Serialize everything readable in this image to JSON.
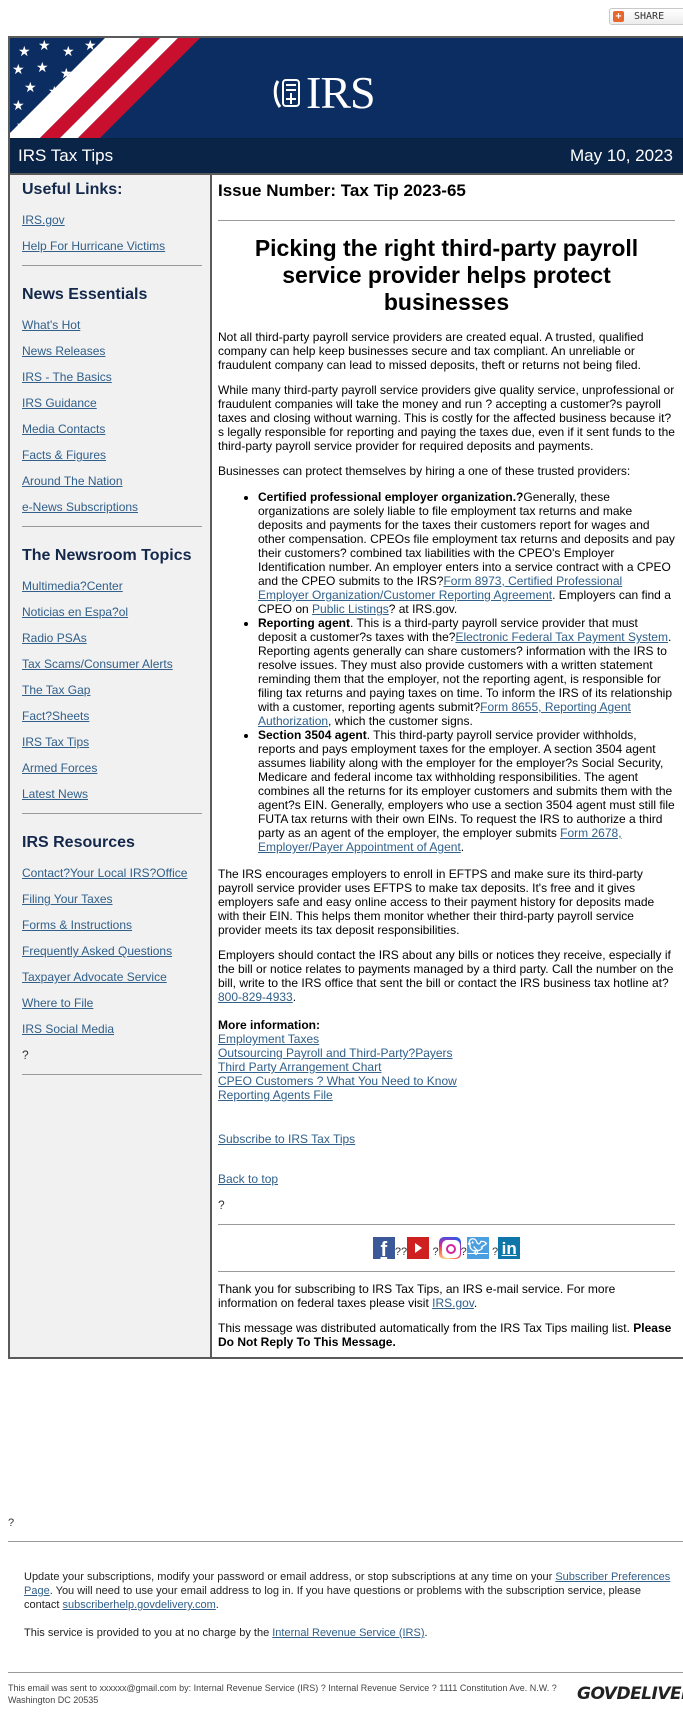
{
  "share": {
    "label": "SHARE",
    "icon": "plus-square-icon"
  },
  "banner": {
    "logo_text": "IRS",
    "logo_icon": "irs-eagle-seal-icon"
  },
  "titlebar": {
    "title": "IRS Tax Tips",
    "date": "May 10, 2023"
  },
  "sidebar": {
    "sections": [
      {
        "heading": "Useful Links:",
        "links": [
          "IRS.gov",
          "Help For Hurricane Victims"
        ]
      },
      {
        "heading": "News Essentials",
        "links": [
          "What's Hot",
          "News Releases",
          "IRS - The Basics",
          "IRS Guidance",
          "Media Contacts",
          "Facts & Figures",
          "Around The Nation",
          "e-News Subscriptions"
        ]
      },
      {
        "heading": "The Newsroom Topics",
        "links": [
          "Multimedia?Center",
          "Noticias en Espa?ol",
          "Radio PSAs",
          "Tax Scams/Consumer Alerts",
          "The Tax Gap",
          "Fact?Sheets",
          "IRS Tax Tips",
          "Armed Forces",
          "Latest News"
        ]
      },
      {
        "heading": "IRS Resources",
        "links": [
          "Contact?Your Local IRS?Office",
          "Filing Your Taxes",
          "Forms & Instructions",
          "Frequently Asked Questions",
          "Taxpayer Advocate Service",
          "Where to File",
          "IRS Social Media"
        ],
        "trailing": "?"
      }
    ]
  },
  "main": {
    "issue": "Issue Number: Tax Tip 2023-65",
    "headline": "Picking the right third-party payroll service provider helps protect businesses",
    "paragraphs": [
      "Not all third-party payroll service providers are created equal. A trusted, qualified company can help keep businesses secure and tax compliant. An unreliable or fraudulent company can lead to missed deposits, theft or returns not being filed.",
      "While many third-party payroll service providers give quality service, unprofessional or fraudulent companies will take the money and run ? accepting a customer?s payroll taxes and closing without warning. This is costly for the affected business because it?s legally responsible for reporting and paying the taxes due, even if it sent funds to the third-party payroll service provider for required deposits and payments.",
      "Businesses can protect themselves by hiring a one of these trusted providers:"
    ],
    "bullets": [
      {
        "bold": "Certified professional employer organization.?",
        "text1": "Generally, these organizations are solely liable to file employment tax returns and make deposits and payments for the taxes their customers report for wages and other compensation. CPEOs file employment tax returns and deposits and pay their customers? combined tax liabilities with the CPEO's Employer Identification number. An employer enters into a service contract with a CPEO and the CPEO submits to the IRS?",
        "link1": "Form 8973, Certified Professional Employer Organization/Customer Reporting Agreement",
        "text2": ". Employers can find a CPEO on ",
        "link2": "Public Listings",
        "text3": "? at IRS.gov."
      },
      {
        "bold": "Reporting agent",
        "text1": ". This is a third-party payroll service provider that must deposit a customer?s taxes with the?",
        "link1": "Electronic Federal Tax Payment System",
        "text2": ". Reporting agents generally can share customers? information with the IRS to resolve issues. They must also provide customers with a written statement reminding them that the employer, not the reporting agent, is responsible for filing tax returns and paying taxes on time. To inform the IRS of its relationship with a customer, reporting agents submit?",
        "link2": "Form 8655, Reporting Agent Authorization",
        "text3": ", which the customer signs."
      },
      {
        "bold": "Section 3504 agent",
        "text1": ". This third-party payroll service provider withholds, reports and pays employment taxes for the employer. A section 3504 agent assumes liability along with the employer for the employer?s Social Security, Medicare and federal income tax withholding responsibilities. The agent combines all the returns for its employer customers and submits them with the agent?s EIN. Generally, employers who use a section 3504 agent must still file FUTA tax returns with their own EINs. To request the IRS to authorize a third party as an agent of the employer, the employer submits ",
        "link1": "Form 2678, Employer/Payer Appointment of Agent",
        "text2": ".",
        "link2": "",
        "text3": ""
      }
    ],
    "eftps_paragraph": "The IRS encourages employers to enroll in EFTPS and make sure its third-party payroll service provider uses EFTPS to make tax deposits. It's free and it gives employers safe and easy online access to their payment history for deposits made with their EIN. This helps them monitor whether their third-party payroll service provider meets its tax deposit responsibilities.",
    "contact_paragraph": "Employers should contact the IRS about any bills or notices they receive, especially if the bill or notice relates to payments managed by a third party. Call the number on the bill, write to the IRS office that sent the bill or contact the IRS business tax hotline at?",
    "hotline": "800-829-4933",
    "more_info": {
      "title": "More information:",
      "links": [
        "Employment Taxes",
        "Outsourcing Payroll and Third-Party?Payers",
        "Third Party Arrangement Chart",
        "CPEO Customers ? What You Need to Know",
        "Reporting Agents File"
      ]
    },
    "subscribe_link": "Subscribe to IRS Tax Tips",
    "back_to_top": "Back to top",
    "stray_q": "?",
    "social": {
      "icons": [
        "facebook-icon",
        "youtube-icon",
        "instagram-icon",
        "twitter-icon",
        "linkedin-icon"
      ],
      "separators": [
        "??",
        "?",
        "?",
        "?"
      ]
    },
    "thanks_text": "Thank you for subscribing to IRS Tax Tips, an IRS e-mail service. For more information on federal taxes please visit ",
    "thanks_link": "IRS.gov",
    "distributed_text": "This message was distributed automatically from the IRS Tax Tips mailing list. ",
    "distributed_bold": "Please Do Not Reply To This Message."
  },
  "footer": {
    "stray_q": "?",
    "update_text1": "Update your subscriptions, modify your password or email address, or stop subscriptions at any time on your ",
    "update_link": "Subscriber Preferences Page",
    "update_text2": ". You will need to use your email address to log in. If you have questions or problems with the subscription service, please contact ",
    "help_link": "subscriberhelp.govdelivery.com",
    "update_text3": ".",
    "service_text": "This service is provided to you at no charge by the ",
    "service_link": "Internal Revenue Service (IRS)",
    "service_end": ".",
    "sent_text": "This email was sent to xxxxxx@gmail.com by: Internal Revenue Service (IRS) ? Internal Revenue Service ? 1111 Constitution Ave. N.W. ? Washington DC 20535",
    "govdelivery_logo": "GOVDELIVERY"
  }
}
